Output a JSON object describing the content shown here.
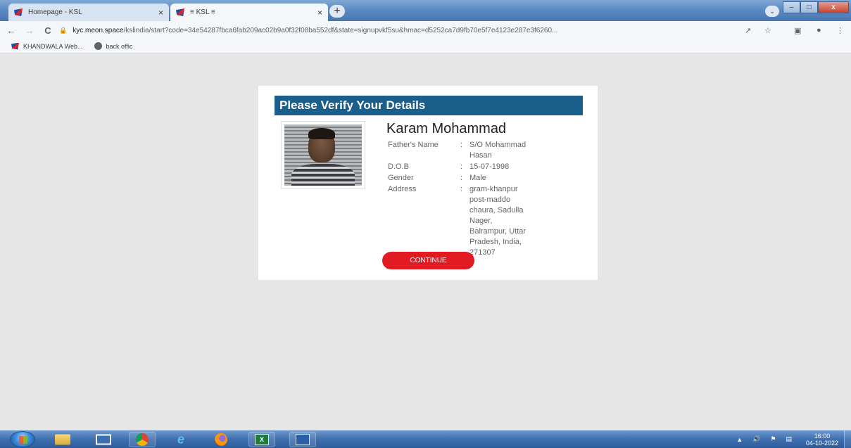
{
  "browser": {
    "tabs": [
      {
        "label": "Homepage - KSL",
        "close": "×",
        "active": false
      },
      {
        "label": "≡ KSL ≡",
        "close": "×",
        "active": true
      }
    ],
    "new_tab": "+",
    "url_host": "kyc.meon.space",
    "url_path": "/kslindia/start?code=34e54287fbca6fab209ac02b9a0f32f08ba552df&state=signupvkf5su&hmac=d5252ca7d9fb70e5f7e4123e287e3f6260...",
    "nav": {
      "back": "←",
      "forward": "→",
      "reload": "C"
    },
    "bookmarks": [
      {
        "label": "KHANDWALA Web..."
      },
      {
        "label": "back offic"
      }
    ]
  },
  "card": {
    "title": "Please Verify Your Details",
    "name": "Karam Mohammad",
    "fields": [
      {
        "key": "Father's Name",
        "sep": ":",
        "value": "S/O Mohammad Hasan"
      },
      {
        "key": "D.O.B",
        "sep": ":",
        "value": "15-07-1998"
      },
      {
        "key": "Gender",
        "sep": ":",
        "value": "Male"
      },
      {
        "key": "Address",
        "sep": ":",
        "value": "gram-khanpur post-maddo chaura, Sadulla Nager, Balrampur, Uttar Pradesh, India, 271307"
      }
    ],
    "continue_label": "CONTINUE"
  },
  "taskbar": {
    "time": "16:00",
    "date": "04-10-2022"
  },
  "colors": {
    "header_bg": "#1a5f8c",
    "continue_bg": "#e21b23",
    "page_bg": "#e6e6e6"
  }
}
